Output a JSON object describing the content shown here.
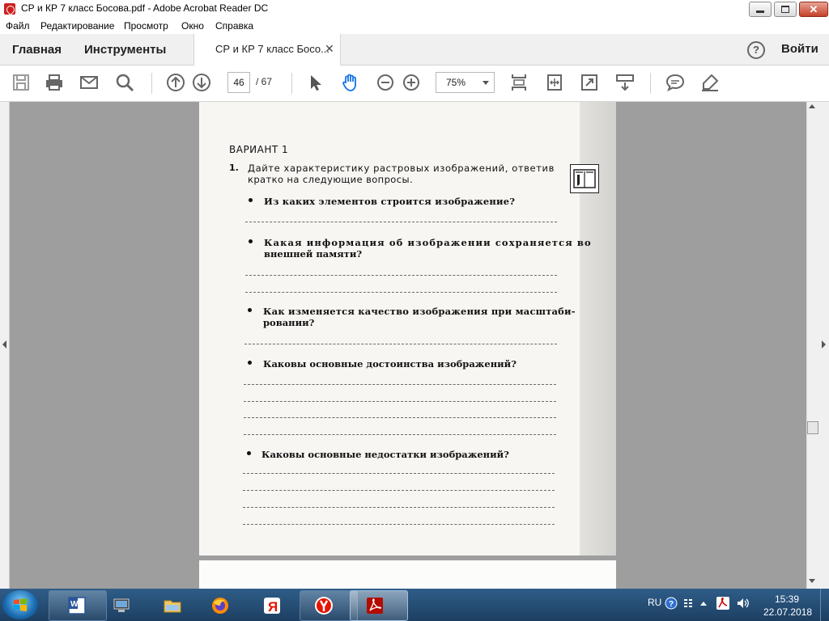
{
  "window": {
    "title": "СР и КР 7 класс Босова.pdf - Adobe Acrobat Reader DC"
  },
  "menu": [
    "Файл",
    "Редактирование",
    "Просмотр",
    "Окно",
    "Справка"
  ],
  "tabs": {
    "home": "Главная",
    "tools": "Инструменты",
    "document": "СР и КР 7 класс Босо...",
    "signin": "Войти"
  },
  "toolbar": {
    "page_current": "46",
    "page_total": "/ 67",
    "zoom": "75%"
  },
  "document": {
    "variant": "ВАРИАНТ 1",
    "task_number": "1.",
    "task_line1": "Дайте характеристику растровых изображений, ответив",
    "task_line2": "кратко на следующие вопросы.",
    "q1": "Из каких элементов строится изображение?",
    "q2_line1": "Какая информация об изображении сохраняется во",
    "q2_line2": "внешней памяти?",
    "q3_line1": "Как изменяется качество изображения при масштаби-",
    "q3_line2": "ровании?",
    "q4": "Каковы основные достоинства изображений?",
    "q5": "Каковы основные недостатки изображений?"
  },
  "taskbar": {
    "lang": "RU",
    "time": "15:39",
    "date": "22.07.2018"
  },
  "colors": {
    "taskbar": "#1d3f62",
    "doc_background": "#9e9e9e",
    "acrobat_red": "#cf1f1f"
  },
  "icons": [
    "save-icon",
    "print-icon",
    "email-icon",
    "search-icon",
    "page-up-icon",
    "page-down-icon",
    "select-arrow-icon",
    "hand-icon",
    "zoom-out-icon",
    "zoom-in-icon",
    "fit-page-icon",
    "fit-width-icon",
    "fullscreen-icon",
    "scroll-mode-icon",
    "comment-icon",
    "highlight-icon"
  ]
}
